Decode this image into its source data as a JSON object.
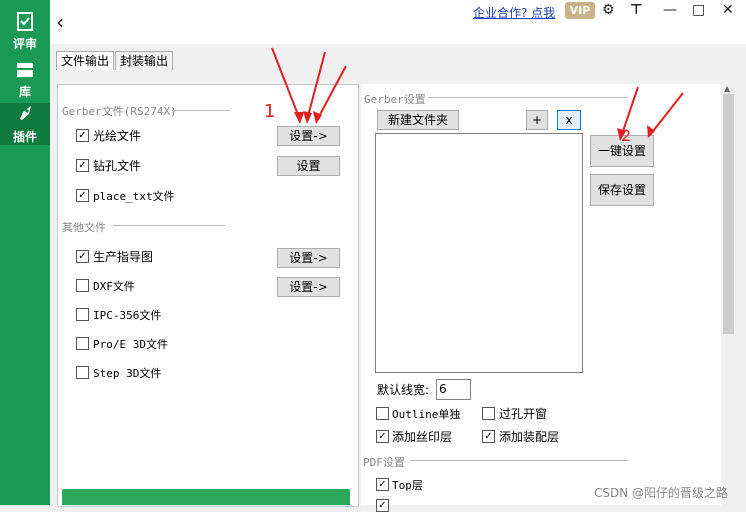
{
  "nav": {
    "items": [
      {
        "label": "评审"
      },
      {
        "label": "库"
      },
      {
        "label": "插件"
      }
    ]
  },
  "topbar": {
    "back_glyph": "‹",
    "biz_link": "企业合作? 点我",
    "vip": "VIP"
  },
  "tabs": [
    {
      "label": "文件输出"
    },
    {
      "label": "封装输出"
    }
  ],
  "gerber_group": {
    "title": "Gerber文件(RS274X)",
    "items": [
      {
        "label": "光绘文件",
        "checked": true
      },
      {
        "label": "钻孔文件",
        "checked": true
      },
      {
        "label": "place_txt文件",
        "checked": true
      }
    ],
    "btn_photo": "设置->",
    "btn_drill": "设置"
  },
  "other_group": {
    "title": "其他文件",
    "items": [
      {
        "label": "生产指导图",
        "checked": true
      },
      {
        "label": "DXF文件",
        "checked": false
      },
      {
        "label": "IPC-356文件",
        "checked": false
      },
      {
        "label": "Pro/E 3D文件",
        "checked": false
      },
      {
        "label": "Step 3D文件",
        "checked": false
      }
    ],
    "btn_guide": "设置->",
    "btn_dxf": "设置->"
  },
  "gerber_settings": {
    "title": "Gerber设置",
    "new_folder": "新建文件夹",
    "plus": "+",
    "x": "x",
    "one_click": "一键设置",
    "save": "保存设置",
    "linewidth_label": "默认线宽:",
    "linewidth_value": "6",
    "checks": [
      {
        "label": "Outline单独",
        "checked": false
      },
      {
        "label": "过孔开窗",
        "checked": false
      },
      {
        "label": "添加丝印层",
        "checked": true
      },
      {
        "label": "添加装配层",
        "checked": true
      }
    ]
  },
  "pdf_settings": {
    "title": "PDF设置",
    "top": {
      "label": "Top层",
      "checked": true
    }
  },
  "annotations": {
    "n1": "1",
    "n2": "2"
  },
  "watermark": "CSDN @阳仔的晋级之路",
  "colors": {
    "nav_green": "#1b9a55",
    "arrow_red": "#e02020",
    "button_green": "#2ba85c"
  }
}
